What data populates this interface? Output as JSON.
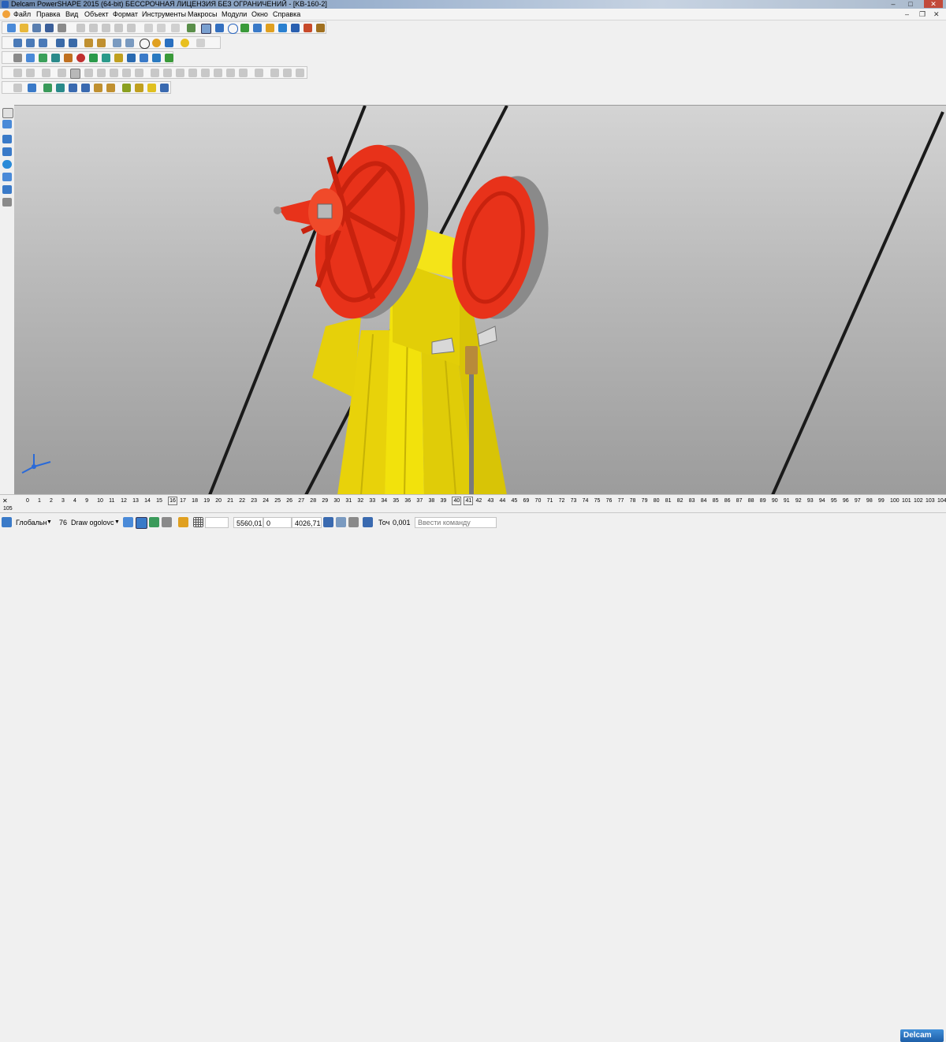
{
  "window": {
    "title": "Delcam PowerSHAPE 2015 (64-bit) БЕССРОЧНАЯ ЛИЦЕНЗИЯ БЕЗ ОГРАНИЧЕНИЙ - [KB-160-2]",
    "minimize": "–",
    "maximize": "□",
    "close": "✕"
  },
  "menu": {
    "items": [
      "Файл",
      "Правка",
      "Вид",
      "Объект",
      "Формат",
      "Инструменты",
      "Макросы",
      "Модули",
      "Окно",
      "Справка"
    ],
    "mdi_minimize": "–",
    "mdi_restore": "❐",
    "mdi_close": "✕"
  },
  "layers": {
    "labels": [
      "0",
      "1",
      "2",
      "3",
      "4",
      "9",
      "10",
      "11",
      "12",
      "13",
      "14",
      "15",
      "16",
      "17",
      "18",
      "19",
      "20",
      "21",
      "22",
      "23",
      "24",
      "25",
      "26",
      "27",
      "28",
      "29",
      "30",
      "31",
      "32",
      "33",
      "34",
      "35",
      "36",
      "37",
      "38",
      "39",
      "40",
      "41",
      "42",
      "43",
      "44",
      "45",
      "69",
      "70",
      "71",
      "72",
      "73",
      "74",
      "75",
      "76",
      "77",
      "78",
      "79",
      "80",
      "81",
      "82",
      "83",
      "84",
      "85",
      "86",
      "87",
      "88",
      "89",
      "90",
      "91",
      "92",
      "93",
      "94",
      "95",
      "96",
      "97",
      "98",
      "99",
      "100",
      "101",
      "102",
      "103",
      "104"
    ],
    "overflow_label": "105",
    "active": [
      "16",
      "40",
      "41"
    ]
  },
  "status": {
    "workplane": "Глобальн",
    "level": "76",
    "level_name": "Draw ogolovc",
    "coord_x": "5560,01",
    "coord_y": "0",
    "coord_z": "4026,71",
    "tolerance_label": "Точ",
    "tolerance_value": "0,001",
    "command_placeholder": "Ввести команду"
  },
  "brand": {
    "logo": "Delcam"
  },
  "colors": {
    "wheel": "#e8321a",
    "frame": "#f2e20c",
    "rope": "#1a1a1a",
    "groove": "#8a8a8a",
    "viewport_top": "#d4d4d4",
    "viewport_bottom": "#9c9c9c"
  }
}
